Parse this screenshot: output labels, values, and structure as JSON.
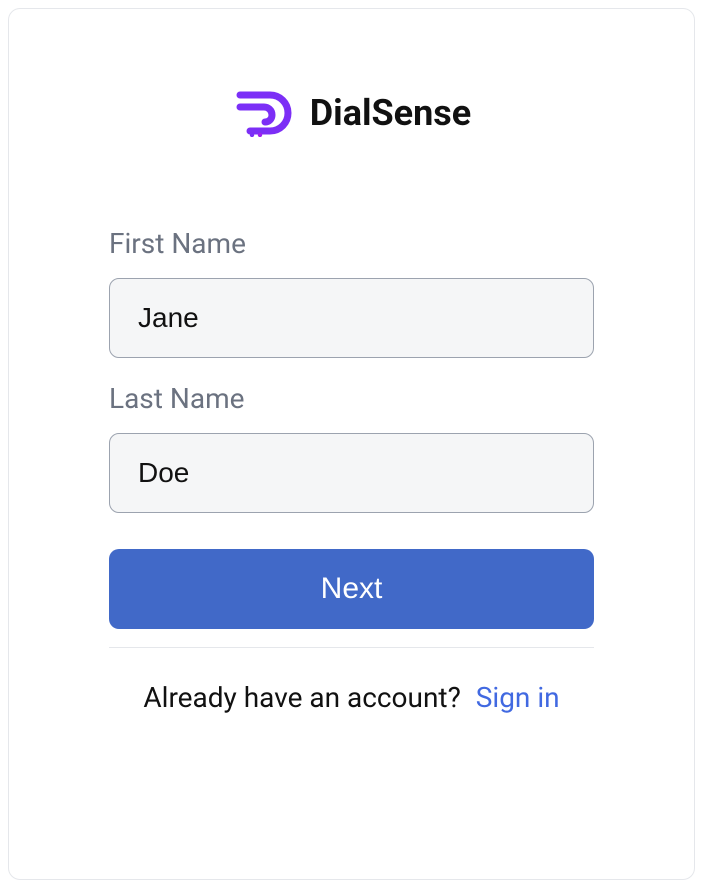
{
  "brand": {
    "name": "DialSense"
  },
  "form": {
    "first_name": {
      "label": "First Name",
      "value": "Jane"
    },
    "last_name": {
      "label": "Last Name",
      "value": "Doe"
    },
    "submit_label": "Next"
  },
  "footer": {
    "prompt": "Already have an account?",
    "link_text": "Sign in"
  }
}
